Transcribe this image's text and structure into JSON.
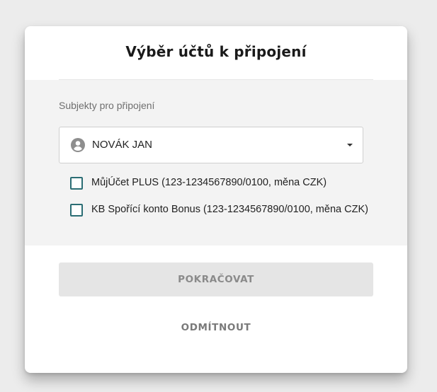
{
  "dialog": {
    "title": "Výběr účtů k připojení"
  },
  "subjects": {
    "label": "Subjekty pro připojení",
    "selected": "NOVÁK JAN",
    "icon": "person-icon"
  },
  "accounts": [
    {
      "label": "MůjÚčet PLUS (123-1234567890/0100, měna CZK)",
      "checked": false
    },
    {
      "label": "KB Spořící konto Bonus (123-1234567890/0100, měna CZK)",
      "checked": false
    }
  ],
  "actions": {
    "continue_label": "POKRAČOVAT",
    "decline_label": "ODMÍTNOUT"
  },
  "colors": {
    "checkbox_border": "#2b6d74",
    "section_background": "#f3f3f3",
    "disabled_button": "#e5e5e5"
  }
}
